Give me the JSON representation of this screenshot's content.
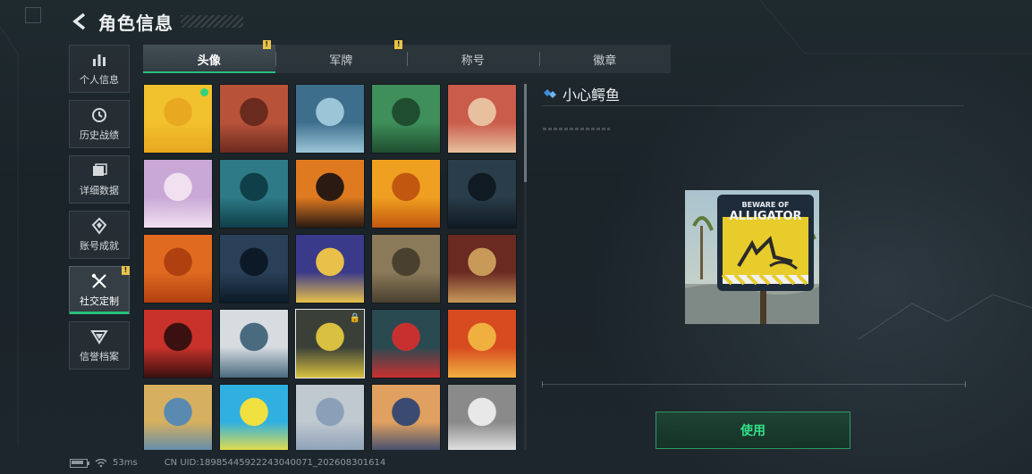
{
  "header": {
    "title": "角色信息"
  },
  "sidebar": {
    "items": [
      {
        "label": "个人信息",
        "icon": "bar-chart-icon"
      },
      {
        "label": "历史战绩",
        "icon": "history-icon"
      },
      {
        "label": "详细数据",
        "icon": "data-folder-icon"
      },
      {
        "label": "账号成就",
        "icon": "achievement-icon"
      },
      {
        "label": "社交定制",
        "icon": "tools-icon",
        "active": true,
        "badge": "!"
      },
      {
        "label": "信誉档案",
        "icon": "shield-icon"
      }
    ]
  },
  "tabs": [
    {
      "label": "头像",
      "active": true,
      "badge": "!"
    },
    {
      "label": "军牌",
      "badge": "!"
    },
    {
      "label": "称号"
    },
    {
      "label": "徽章"
    }
  ],
  "avatar_grid": {
    "items": [
      {
        "name": "avatar-yellow-cartoon",
        "equipped": true
      },
      {
        "name": "avatar-bearded-soldier"
      },
      {
        "name": "avatar-pilot-woman"
      },
      {
        "name": "avatar-headset-man"
      },
      {
        "name": "avatar-helmet-woman"
      },
      {
        "name": "avatar-white-hair-girl"
      },
      {
        "name": "avatar-glasses-man"
      },
      {
        "name": "avatar-masked-fighter"
      },
      {
        "name": "avatar-gold-emblem"
      },
      {
        "name": "avatar-night-soldier"
      },
      {
        "name": "avatar-heavy-gunner"
      },
      {
        "name": "avatar-sniper-scope"
      },
      {
        "name": "avatar-gold-card"
      },
      {
        "name": "avatar-rusty-truck"
      },
      {
        "name": "avatar-scales-emblem"
      },
      {
        "name": "avatar-red-hair-woman"
      },
      {
        "name": "avatar-climber-girl"
      },
      {
        "name": "avatar-alligator-sign",
        "selected": true,
        "locked": true
      },
      {
        "name": "avatar-goggles-guy"
      },
      {
        "name": "avatar-monkey-reader"
      },
      {
        "name": "avatar-pyramid-tourist"
      },
      {
        "name": "avatar-neon-triangle"
      },
      {
        "name": "avatar-blonde-soldier"
      },
      {
        "name": "avatar-goggle-girl"
      },
      {
        "name": "avatar-white-eagle"
      }
    ]
  },
  "detail": {
    "name": "小心鳄鱼",
    "preview_text_top": "BEWARE OF",
    "preview_text_main": "ALLIGATOR",
    "use_button": "使用"
  },
  "status_bar": {
    "ping": "53ms",
    "uid": "CN UID:18985445922243040071_202608301614"
  },
  "colors": {
    "accent": "#29c07a",
    "badge": "#e9c24a",
    "button_text": "#34e08a"
  }
}
